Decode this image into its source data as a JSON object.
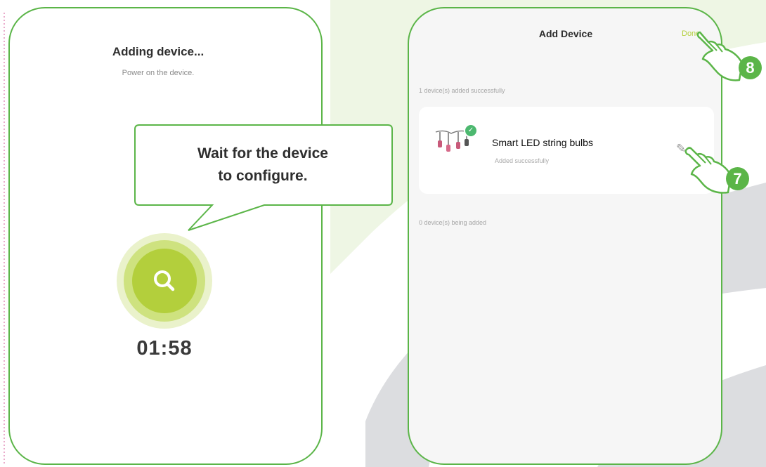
{
  "left_screen": {
    "title": "Adding device...",
    "subtitle": "Power on the device.",
    "timer": "01:58",
    "scan_icon": "search-icon"
  },
  "callout": {
    "line1": "Wait for the device",
    "line2": "to configure."
  },
  "right_screen": {
    "header_title": "Add Device",
    "done_label": "Done",
    "added_section_label": "1 device(s) added successfully",
    "device": {
      "name": "Smart LED string bulbs",
      "status": "Added successfully",
      "icon": "string-lights-icon",
      "badge_icon": "check-icon",
      "edit_icon": "pencil-icon"
    },
    "failed_section_label": "0 device(s) being added"
  },
  "steps": [
    {
      "number": "8",
      "target": "done-button"
    },
    {
      "number": "7",
      "target": "edit-name-button"
    }
  ],
  "colors": {
    "frame_green": "#5bb548",
    "scan_yellow_green": "#b3cf3c",
    "step_green": "#5bb548",
    "background_swoosh": "#dcdde0",
    "background_light_green": "#eef6e4"
  }
}
